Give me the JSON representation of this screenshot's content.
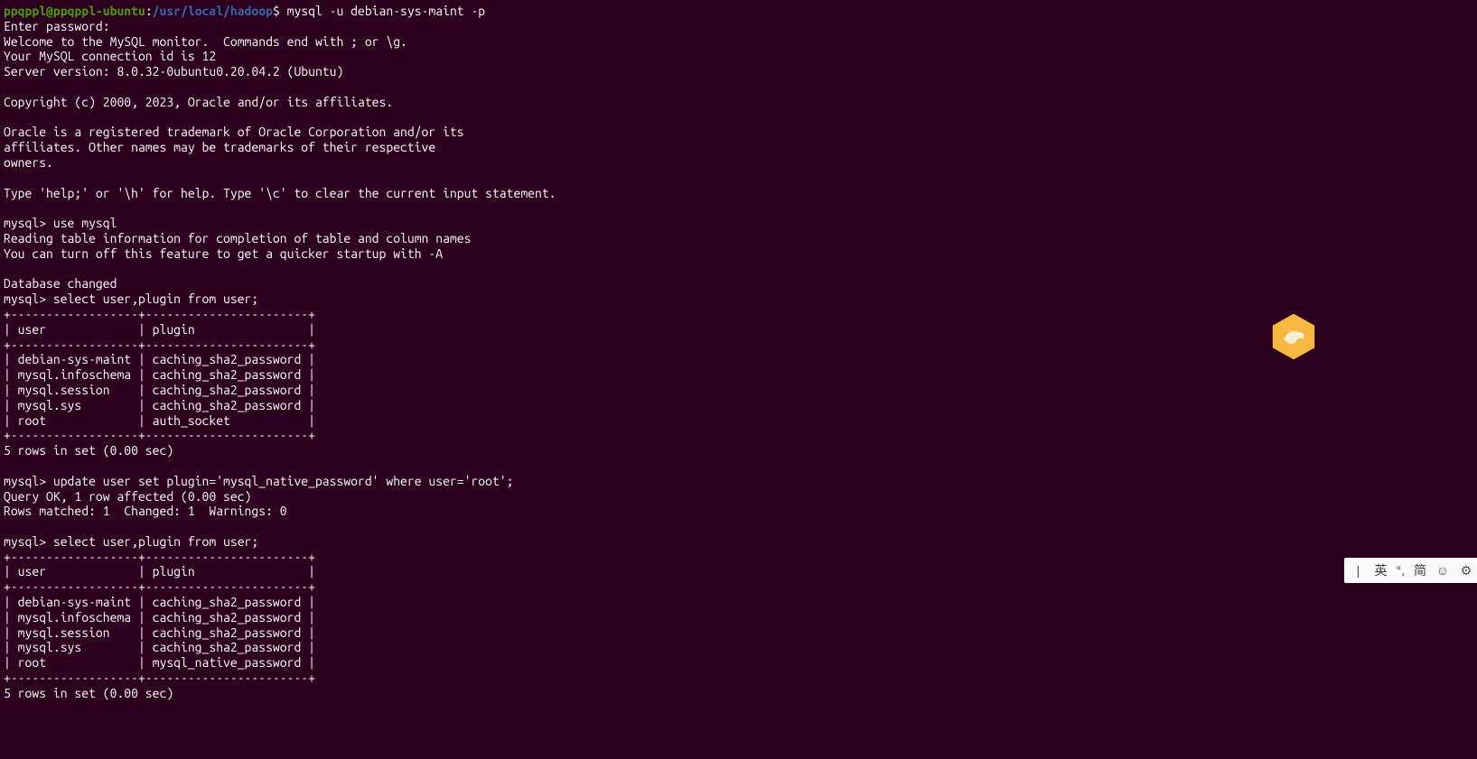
{
  "prompt": {
    "user": "ppqppl@ppqppl-ubuntu",
    "colon": ":",
    "path": "/usr/local/hadoop",
    "dollar": "$",
    "command": " mysql -u debian-sys-maint -p"
  },
  "lines": {
    "l1": "Enter password:",
    "l2": "Welcome to the MySQL monitor.  Commands end with ; or \\g.",
    "l3": "Your MySQL connection id is 12",
    "l4": "Server version: 8.0.32-0ubuntu0.20.04.2 (Ubuntu)",
    "l5": "",
    "l6": "Copyright (c) 2000, 2023, Oracle and/or its affiliates.",
    "l7": "",
    "l8": "Oracle is a registered trademark of Oracle Corporation and/or its",
    "l9": "affiliates. Other names may be trademarks of their respective",
    "l10": "owners.",
    "l11": "",
    "l12": "Type 'help;' or '\\h' for help. Type '\\c' to clear the current input statement.",
    "l13": "",
    "l14": "mysql> use mysql",
    "l15": "Reading table information for completion of table and column names",
    "l16": "You can turn off this feature to get a quicker startup with -A",
    "l17": "",
    "l18": "Database changed",
    "l19": "mysql> select user,plugin from user;",
    "t1_border": "+------------------+-----------------------+",
    "t1_header": "| user             | plugin                |",
    "t1_r1": "| debian-sys-maint | caching_sha2_password |",
    "t1_r2": "| mysql.infoschema | caching_sha2_password |",
    "t1_r3": "| mysql.session    | caching_sha2_password |",
    "t1_r4": "| mysql.sys        | caching_sha2_password |",
    "t1_r5": "| root             | auth_socket           |",
    "t1_footer": "5 rows in set (0.00 sec)",
    "l20": "",
    "l21": "mysql> update user set plugin='mysql_native_password' where user='root';",
    "l22": "Query OK, 1 row affected (0.00 sec)",
    "l23": "Rows matched: 1  Changed: 1  Warnings: 0",
    "l24": "",
    "l25": "mysql> select user,plugin from user;",
    "t2_r5": "| root             | mysql_native_password |",
    "t2_footer": "5 rows in set (0.00 sec)"
  },
  "ime": {
    "divider": "|",
    "lang1": "英",
    "punct": "°,",
    "lang2": "简",
    "face": "☺",
    "gear": "⚙"
  }
}
